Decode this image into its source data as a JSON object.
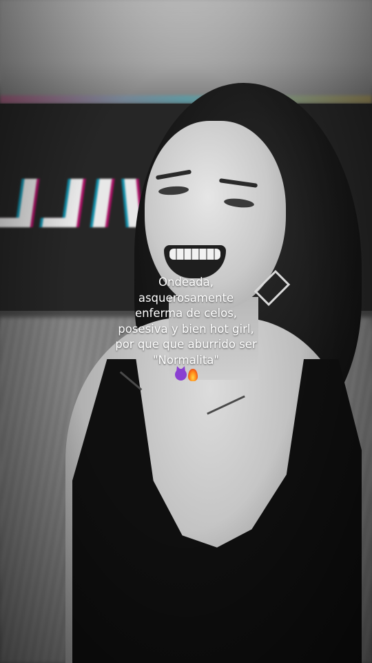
{
  "background": {
    "banner_text": "WILL"
  },
  "caption": {
    "lines": [
      "Ondeada,",
      "asquerosamente",
      "enferma de celos,",
      "posesiva y bien hot girl,",
      "por que que aburrido ser",
      "\"Normalita\""
    ],
    "emojis": [
      "smiling-devil-emoji",
      "fire-emoji"
    ]
  }
}
